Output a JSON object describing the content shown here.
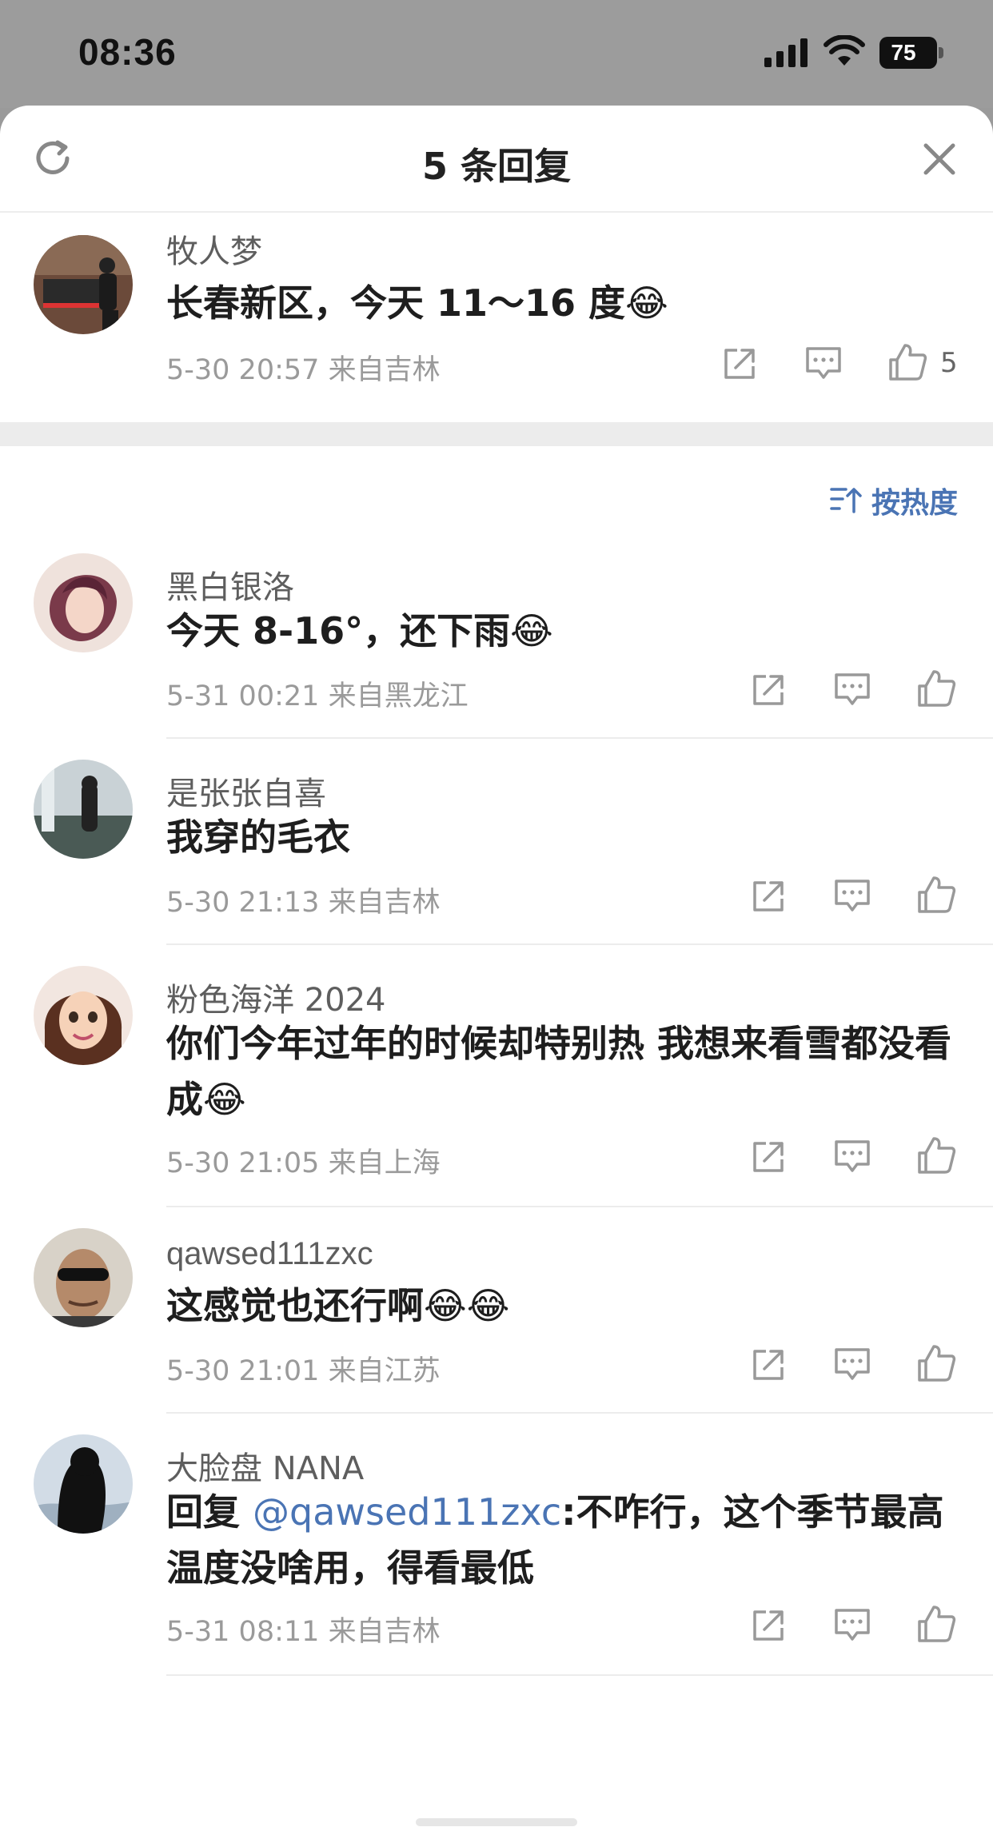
{
  "status_bar": {
    "time": "08:36",
    "battery": "75"
  },
  "header": {
    "title": "5 条回复"
  },
  "root_comment": {
    "username": "牧人梦",
    "text": "长春新区，今天 11～16 度",
    "emoji": "😂",
    "date": "5-30 20:57",
    "location": "来自吉林",
    "likes": "5"
  },
  "sort": {
    "label": "按热度"
  },
  "replies": [
    {
      "username": "黑白银洛",
      "text": "今天 8-16°，还下雨",
      "emoji": "😂",
      "date": "5-31 00:21",
      "location": "来自黑龙江"
    },
    {
      "username": "是张张自喜",
      "text": "我穿的毛衣",
      "date": "5-30 21:13",
      "location": "来自吉林"
    },
    {
      "username": "粉色海洋 2024",
      "text": "你们今年过年的时候却特别热 我想来看雪都没看成",
      "emoji": "😂",
      "date": "5-30 21:05",
      "location": "来自上海"
    },
    {
      "username": "qawsed111zxc",
      "text": "这感觉也还行啊",
      "emoji": "😂😂",
      "date": "5-30 21:01",
      "location": "来自江苏"
    },
    {
      "username": "大脸盘 NANA",
      "reply_prefix": "回复 ",
      "mention": "@qawsed111zxc",
      "text": ":不咋行，这个季节最高温度没啥用，得看最低",
      "date": "5-31 08:11",
      "location": "来自吉林"
    }
  ],
  "colors": {
    "link": "#4a74b4",
    "meta": "#9a9a9a",
    "divider": "#ececec"
  }
}
